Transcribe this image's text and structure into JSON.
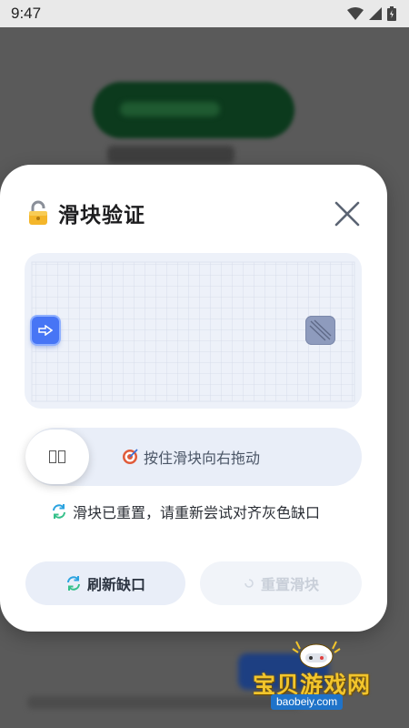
{
  "status_bar": {
    "time": "9:47"
  },
  "modal": {
    "title": "滑块验证",
    "slider_hint": "按住滑块向右拖动",
    "status_message": "滑块已重置，请重新尝试对齐灰色缺口",
    "refresh_label": "刷新缺口",
    "reset_label": "重置滑块"
  },
  "watermark": {
    "title": "宝贝游戏网",
    "url": "baobeiy.com"
  },
  "colors": {
    "piece": "#4775f5",
    "gap": "#8e9bbd",
    "track": "#e9eef8",
    "watermark_gold": "#f2c52c"
  },
  "icons": {
    "title": "lock-icon",
    "close": "close-icon",
    "piece": "arrow-right-icon",
    "hint": "target-icon",
    "status": "refresh-icon"
  }
}
